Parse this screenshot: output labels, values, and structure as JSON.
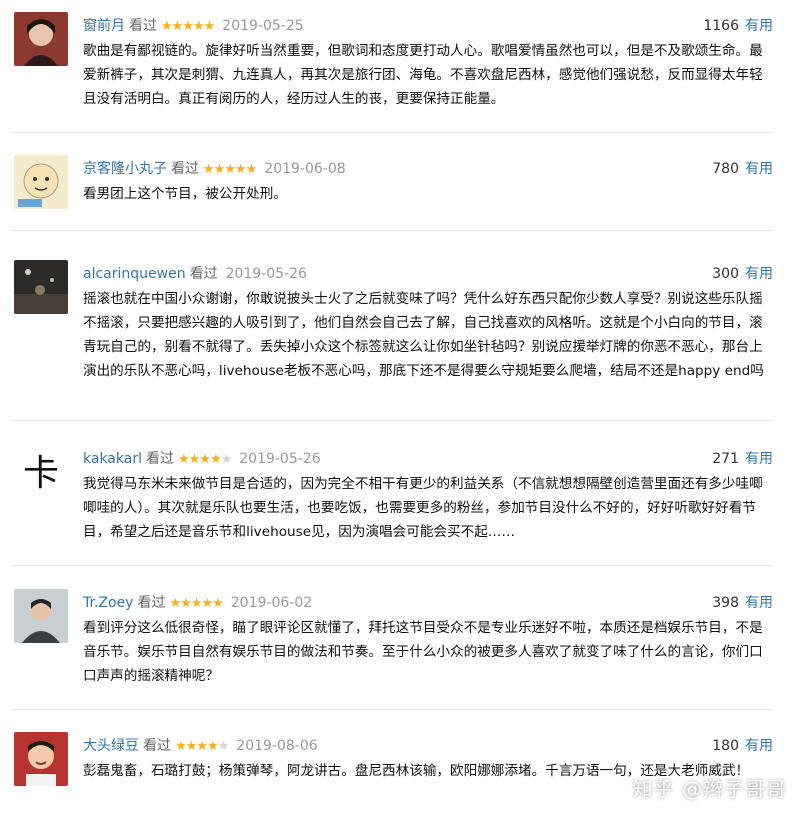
{
  "reviews": [
    {
      "user": "窗前月",
      "watched": "看过",
      "rating": 5,
      "date": "2019-05-25",
      "votes": "1166",
      "useful": "有用",
      "text": "歌曲是有鄙视链的。旋律好听当然重要，但歌词和态度更打动人心。歌唱爱情虽然也可以，但是不及歌颂生命。最爱新裤子，其次是刺猬、九连真人，再其次是旅行团、海龟。不喜欢盘尼西林，感觉他们强说愁，反而显得太年轻且没有活明白。真正有阅历的人，经历过人生的丧，更要保持正能量。"
    },
    {
      "user": "京客隆小丸子",
      "watched": "看过",
      "rating": 5,
      "date": "2019-06-08",
      "votes": "780",
      "useful": "有用",
      "text": "看男团上这个节目，被公开处刑。"
    },
    {
      "user": "alcarinquewen",
      "watched": "看过",
      "rating": 0,
      "date": "2019-05-26",
      "votes": "300",
      "useful": "有用",
      "text": "摇滚也就在中国小众谢谢，你敢说披头士火了之后就变味了吗？凭什么好东西只配你少数人享受？别说这些乐队摇不摇滚，只要把感兴趣的人吸引到了，他们自然会自己去了解，自己找喜欢的风格听。这就是个小白向的节目，滚青玩自己的，别看不就得了。丢失掉小众这个标签就这么让你如坐针毡吗？别说应援举灯牌的你恶不恶心，那台上演出的乐队不恶心吗，livehouse老板不恶心吗，那底下还不是得要么守规矩要么爬墙，结局不还是happy end吗"
    },
    {
      "user": "kakakarl",
      "watched": "看过",
      "rating": 4,
      "date": "2019-05-26",
      "votes": "271",
      "useful": "有用",
      "text": "我觉得马东米未来做节目是合适的，因为完全不相干有更少的利益关系（不信就想想隔壁创造营里面还有多少哇唧唧哇的人）。其次就是乐队也要生活，也要吃饭，也需要更多的粉丝，参加节目没什么不好的，好好听歌好好看节目，希望之后还是音乐节和livehouse见，因为演唱会可能会买不起……",
      "avatar_glyph": "卡"
    },
    {
      "user": "Tr.Zoey",
      "watched": "看过",
      "rating": 5,
      "date": "2019-06-02",
      "votes": "398",
      "useful": "有用",
      "text": "看到评分这么低很奇怪，瞄了眼评论区就懂了，拜托这节目受众不是专业乐迷好不啦，本质还是档娱乐节目，不是音乐节。娱乐节目自然有娱乐节目的做法和节奏。至于什么小众的被更多人喜欢了就变了味了什么的言论，你们口口声声的摇滚精神呢？"
    },
    {
      "user": "大头绿豆",
      "watched": "看过",
      "rating": 4,
      "date": "2019-08-06",
      "votes": "180",
      "useful": "有用",
      "text": "彭磊鬼畜，石璐打鼓；杨策弹琴，阿龙讲古。盘尼西林该输，欧阳娜娜添堵。千言万语一句，还是大老师威武！"
    }
  ],
  "watermark": "知乎 @辫子哥哥",
  "colors": {
    "link": "#3377aa",
    "star": "#f5b01b",
    "muted": "#999999"
  }
}
